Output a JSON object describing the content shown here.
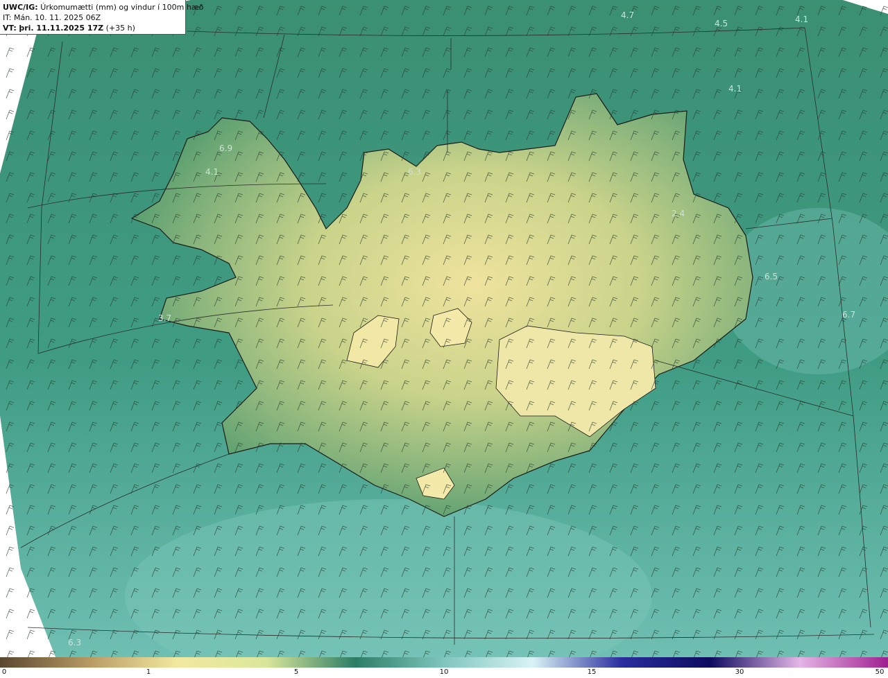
{
  "header": {
    "product_code": "UWC/IG:",
    "product_title": "Úrkomumætti (mm) og vindur í 100m hæð",
    "init_time": "IT: Mán. 10. 11. 2025 06Z",
    "valid_prefix": "VT:",
    "valid_time": "þri. 11.11.2025 17Z",
    "lead_time": "(+35 h)"
  },
  "map_labels": [
    {
      "id": "nw-top-1",
      "text": "4.7"
    },
    {
      "id": "ne-top-1",
      "text": "4.5"
    },
    {
      "id": "ne-top-2",
      "text": "4.1"
    },
    {
      "id": "ne-sea",
      "text": "4.1"
    },
    {
      "id": "westfjords-1",
      "text": "6.9"
    },
    {
      "id": "westfjords-2",
      "text": "4.1"
    },
    {
      "id": "north",
      "text": "6.3"
    },
    {
      "id": "east-1",
      "text": "2.4"
    },
    {
      "id": "east-sea-1",
      "text": "6.5"
    },
    {
      "id": "east-sea-2",
      "text": "6.7"
    },
    {
      "id": "snaefellsnes",
      "text": "3.7"
    },
    {
      "id": "southwest-sea",
      "text": "6.3"
    }
  ],
  "colorbar": {
    "ticks": [
      "0",
      "1",
      "5",
      "10",
      "15",
      "30",
      "50"
    ],
    "colors": [
      "#5a4630",
      "#b79a63",
      "#f2e9a0",
      "#d9e79a",
      "#2d7d66",
      "#7fc6bd",
      "#d8f3f5",
      "#2a2e9e",
      "#0d0b5e",
      "#e4b6e6",
      "#a01f8f"
    ]
  },
  "colors": {
    "sea": "#3f9c83",
    "land_low": "#4f9a6d",
    "land_high": "#e9df98",
    "coastline": "#1a1a1a"
  }
}
